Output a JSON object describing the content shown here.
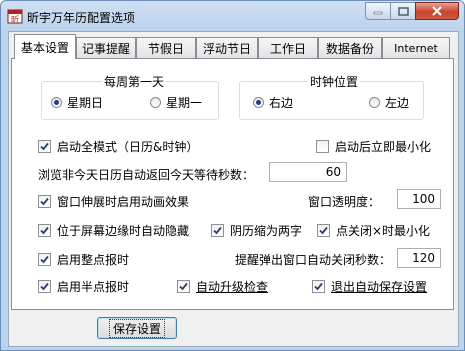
{
  "window": {
    "title": "昕宇万年历配置选项",
    "colors": {
      "titlebar": "#bcd3ee",
      "close": "#c7442c"
    }
  },
  "tabs": [
    {
      "label": "基本设置",
      "active": true
    },
    {
      "label": "记事提醒",
      "active": false
    },
    {
      "label": "节假日",
      "active": false
    },
    {
      "label": "浮动节日",
      "active": false
    },
    {
      "label": "工作日",
      "active": false
    },
    {
      "label": "数据备份",
      "active": false
    },
    {
      "label": "Internet",
      "active": false
    }
  ],
  "week_start": {
    "title": "每周第一天",
    "options": [
      {
        "label": "星期日",
        "selected": true
      },
      {
        "label": "星期一",
        "selected": false
      }
    ]
  },
  "clock_position": {
    "title": "时钟位置",
    "options": [
      {
        "label": "右边",
        "selected": true
      },
      {
        "label": "左边",
        "selected": false
      }
    ]
  },
  "options": {
    "full_mode": {
      "label": "启动全模式（日历&时钟）",
      "checked": true
    },
    "start_minimized": {
      "label": "启动后立即最小化",
      "checked": false
    },
    "browse_wait": {
      "label": "浏览非今天日历自动返回今天等待秒数：",
      "value": "60"
    },
    "animation": {
      "label": "窗口伸展时启用动画效果",
      "checked": true
    },
    "transparency": {
      "label": "窗口透明度：",
      "value": "100"
    },
    "auto_hide": {
      "label": "位于屏幕边缘时自动隐藏",
      "checked": true
    },
    "lunar_two_chars": {
      "label": "阴历缩为两字",
      "checked": true
    },
    "close_minimize": {
      "label": "点关闭×时最小化",
      "checked": true
    },
    "hourly_chime": {
      "label": "启用整点报时",
      "checked": true
    },
    "popup_close": {
      "label": "提醒弹出窗口自动关闭秒数：",
      "value": "120"
    },
    "half_hour_chime": {
      "label": "启用半点报时",
      "checked": true
    },
    "auto_upgrade": {
      "label": "自动升级检查",
      "checked": true
    },
    "save_on_exit": {
      "label": "退出自动保存设置",
      "checked": true
    }
  },
  "buttons": {
    "save": "保存设置"
  }
}
